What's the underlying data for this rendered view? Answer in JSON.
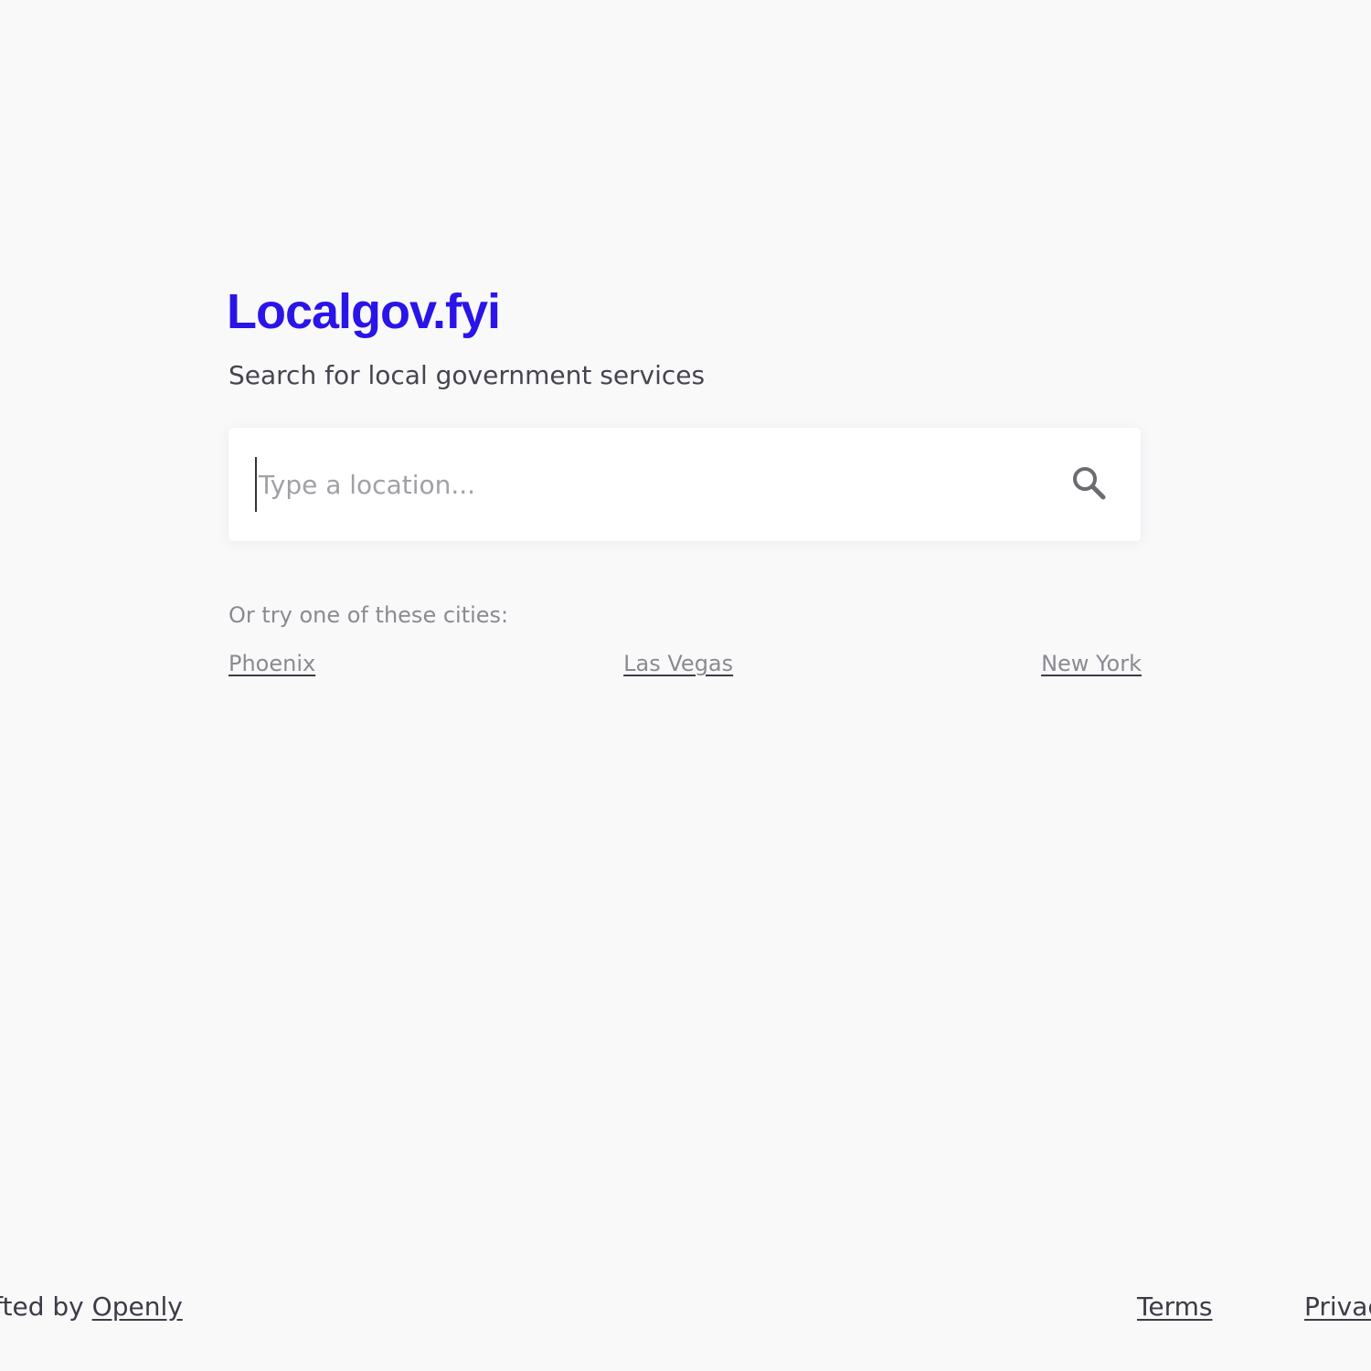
{
  "brand": {
    "name": "Localgov.fyi",
    "color": "#2a14e8"
  },
  "subtitle": "Search for local government services",
  "search": {
    "placeholder": "Type a location...",
    "value": "",
    "icon": "search-icon"
  },
  "suggestions": {
    "label": "Or try one of these cities:",
    "cities": [
      "Phoenix",
      "Las Vegas",
      "New York"
    ]
  },
  "footer": {
    "crafted_prefix": "afted by ",
    "crafted_link": "Openly",
    "links": [
      "Terms",
      "Privac"
    ]
  }
}
